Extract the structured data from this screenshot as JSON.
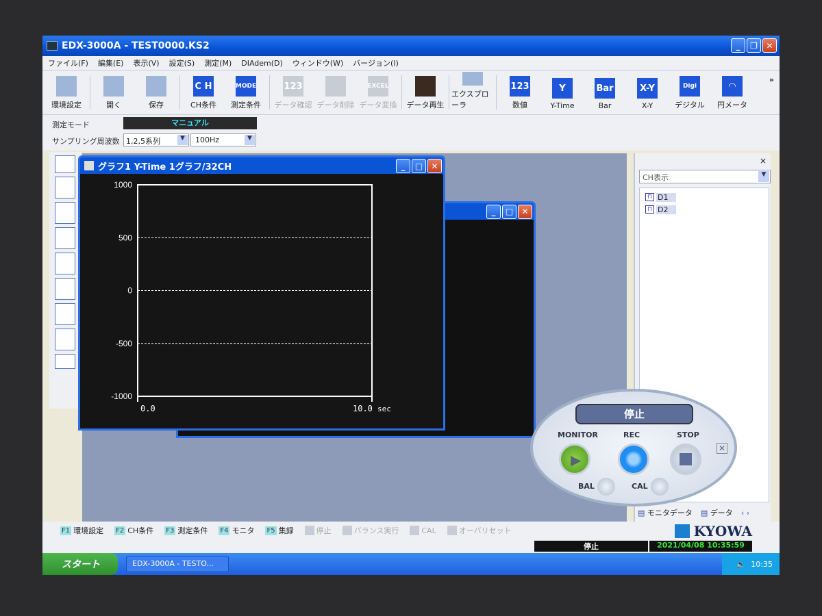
{
  "window": {
    "title": "EDX-3000A - TEST0000.KS2"
  },
  "menu": [
    "ファイル(F)",
    "編集(E)",
    "表示(V)",
    "設定(S)",
    "測定(M)",
    "DIAdem(D)",
    "ウィンドウ(W)",
    "バージョン(I)"
  ],
  "toolbar": [
    {
      "label": "環境設定",
      "icon": "environment-settings-icon",
      "enabled": true
    },
    {
      "label": "開く",
      "icon": "open-folder-icon",
      "enabled": true
    },
    {
      "label": "保存",
      "icon": "save-icon",
      "enabled": true
    },
    {
      "label": "CH条件",
      "icon": "ch-icon",
      "glyph": "C H",
      "enabled": true
    },
    {
      "label": "測定条件",
      "icon": "mode-icon",
      "glyph": "MODE",
      "enabled": true
    },
    {
      "label": "データ確認",
      "icon": "data-check-icon",
      "glyph": "123",
      "enabled": false
    },
    {
      "label": "データ削除",
      "icon": "data-delete-icon",
      "enabled": false
    },
    {
      "label": "データ変換",
      "icon": "data-convert-icon",
      "glyph": "EXCEL",
      "enabled": false
    },
    {
      "label": "データ再生",
      "icon": "data-playback-icon",
      "enabled": true
    },
    {
      "label": "エクスプローラ",
      "icon": "explorer-icon",
      "enabled": true
    },
    {
      "label": "数値",
      "icon": "numeric-icon",
      "glyph": "123",
      "enabled": true
    },
    {
      "label": "Y-Time",
      "icon": "y-time-icon",
      "glyph": "Y",
      "enabled": true
    },
    {
      "label": "Bar",
      "icon": "bar-icon",
      "glyph": "Bar",
      "enabled": true
    },
    {
      "label": "X-Y",
      "icon": "x-y-icon",
      "glyph": "X-Y",
      "enabled": true
    },
    {
      "label": "デジタル",
      "icon": "digital-icon",
      "glyph": "Digi",
      "enabled": true
    },
    {
      "label": "円メータ",
      "icon": "circular-meter-icon",
      "glyph": "◠",
      "enabled": true
    }
  ],
  "toolbar_more": "»",
  "mode": {
    "label": "測定モード",
    "value": "マニュアル"
  },
  "sampling": {
    "label": "サンプリング周波数",
    "series": "1,2,5系列",
    "freq": "100Hz"
  },
  "graph_window": {
    "title": "グラフ1 Y-Time 1グラフ/32CH"
  },
  "chart_data": {
    "type": "line",
    "title": "グラフ1 Y-Time 1グラフ/32CH",
    "xlabel": "sec",
    "ylabel": "",
    "xlim": [
      0.0,
      10.0
    ],
    "ylim": [
      -1000,
      1000
    ],
    "yticks": [
      "1000",
      "500",
      "0",
      "-500",
      "-1000"
    ],
    "xticks": [
      "0.0",
      "10.0"
    ],
    "grid": "dashed at 500, 0, -500",
    "series": []
  },
  "right_panel": {
    "close": "×",
    "dropdown": "CH表示",
    "channels": [
      "D1",
      "D2"
    ],
    "tabs": [
      "モニタデータ",
      "データ"
    ]
  },
  "pad": {
    "status": "停止",
    "monitor": "MONITOR",
    "rec": "REC",
    "stop": "STOP",
    "bal": "BAL",
    "cal": "CAL"
  },
  "fkeys": [
    {
      "key": "F1",
      "label": "環境設定"
    },
    {
      "key": "F2",
      "label": "CH条件"
    },
    {
      "key": "F3",
      "label": "測定条件"
    },
    {
      "key": "F4",
      "label": "モニタ"
    },
    {
      "key": "F5",
      "label": "集録"
    }
  ],
  "fkeys_disabled": [
    "停止",
    "バランス実行",
    "CAL",
    "オーバリセット"
  ],
  "brand": "KYOWA",
  "status": {
    "state": "停止",
    "datetime": "2021/04/08 10:35:59"
  },
  "taskbar": {
    "start": "スタート",
    "task": "EDX-3000A - TESTO...",
    "clock": "10:35"
  },
  "colors": {
    "titlebar": "#0a54d6",
    "mode_value": "#39e6ff",
    "datetime": "#39e639",
    "monitor_btn": "#5cae2a",
    "rec_btn": "#1f8ef0"
  }
}
